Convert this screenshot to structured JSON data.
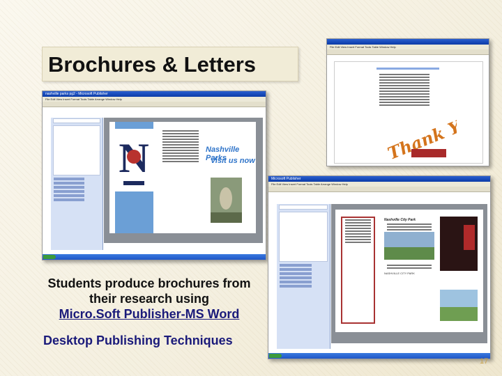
{
  "slide": {
    "title": "Brochures & Letters",
    "caption_line1": "Students produce brochures from",
    "caption_line2": "their research using",
    "caption_link": "Micro.Soft Publisher-MS Word",
    "subtitle": "Desktop Publishing Techniques",
    "page_number": "17"
  },
  "screenshot1": {
    "window_title": "nashville parks pg2 - Microsoft Publisher",
    "brochure_heading1": "Nashville Parks",
    "brochure_heading2": "Visit us now"
  },
  "screenshot2": {
    "thank_you": "Thank You!"
  },
  "screenshot3": {
    "window_title": "Microsoft Publisher",
    "card_text": "Nashville City Park",
    "footer_text": "NASHVILLE CITY PARK"
  },
  "colors": {
    "accent_blue": "#2f74c9",
    "thank_you_orange": "#d4741c",
    "xp_blue": "#1f56c5"
  }
}
